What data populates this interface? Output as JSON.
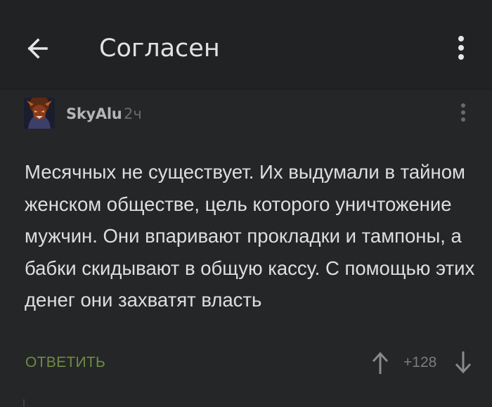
{
  "appbar": {
    "title": "Согласен",
    "back_icon": "arrow-left-icon",
    "menu_icon": "more-vertical-icon"
  },
  "comment": {
    "author": "SkyAlu",
    "time": "2ч",
    "avatar_icon": "avatar-image",
    "menu_icon": "more-vertical-icon",
    "text": "Месячных не существует. Их выдумали в тайном женском обществе, цель которого уничтожение мужчин. Они впаривают прокладки и тампоны, а бабки скидывают в общую кассу. С помощью этих денег они захватят власть",
    "reply_label": "ОТВЕТИТЬ",
    "rating": "+128",
    "vote_up_icon": "arrow-up-icon",
    "vote_down_icon": "arrow-down-icon"
  },
  "colors": {
    "background": "#252627",
    "appbar": "#212223",
    "text": "#dedede",
    "accent_reply": "#6f8c45",
    "muted": "#7c7c7c"
  }
}
